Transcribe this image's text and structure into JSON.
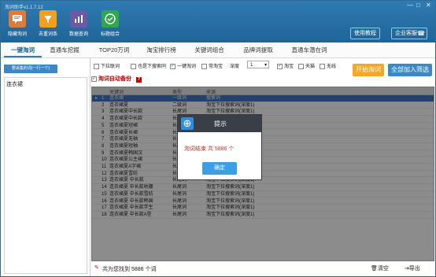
{
  "window": {
    "title": "淘词助手v1.1.7.12",
    "controls": [
      "—",
      "□",
      "✕"
    ]
  },
  "toolbar": [
    {
      "label": "隐藏淘词",
      "color": "#e07a3a",
      "icon": "chat-icon"
    },
    {
      "label": "去重词条",
      "color": "#f0a020",
      "icon": "filter-icon"
    },
    {
      "label": "数据查询",
      "color": "#6a5aa8",
      "icon": "chart-icon"
    },
    {
      "label": "标题组合",
      "color": "#2ea84a",
      "icon": "check-icon"
    }
  ],
  "header_buttons": {
    "tutorial": "使用教程",
    "service": "企业客服"
  },
  "tabs": [
    "一键淘词",
    "直通车挖掘",
    "TOP20万词",
    "淘宝排行榜",
    "关键词组合",
    "品牌词提取",
    "直通车潜在词"
  ],
  "left": {
    "button": "要采集的词(一行一个)",
    "item": "连衣裙"
  },
  "options": [
    {
      "label": "下拉联词",
      "checked": false
    },
    {
      "label": "也是下搜索同",
      "checked": false
    },
    {
      "label": "一键淘词",
      "checked": true
    },
    {
      "label": "常淘宝",
      "checked": false
    },
    {
      "label": "深度",
      "checked": false
    }
  ],
  "depth": "1",
  "platforms": [
    {
      "label": "淘宝",
      "checked": true
    },
    {
      "label": "天猫",
      "checked": false
    },
    {
      "label": "无线",
      "checked": false
    }
  ],
  "start_button": "开始淘词",
  "add_button": "全部加入筛选",
  "auto_backup": "淘词自动备份",
  "help": "?",
  "table": {
    "headers": [
      "关键词",
      "类型",
      "来源"
    ],
    "rows": [
      [
        "1",
        "连衣裙",
        "一级词",
        "搜索词"
      ],
      [
        "2",
        "连衣裙夏",
        "二级词",
        "淘宝下拉搜索词(深度1)"
      ],
      [
        "3",
        "连衣裙夏中长款",
        "长尾词",
        "淘宝下拉搜索词(深度1)"
      ],
      [
        "4",
        "连衣裙夏中长款",
        "长尾词",
        "淘宝下拉搜索词(深度1)"
      ],
      [
        "5",
        "连衣裙夏短裙",
        "长尾词",
        "淘宝下拉搜索词(深度1)"
      ],
      [
        "6",
        "连衣裙夏长裙",
        "长尾词",
        "淘宝下拉搜索词(深度1)"
      ],
      [
        "7",
        "连衣裙夏无袖",
        "长尾词",
        "淘宝下拉搜索词(深度1)"
      ],
      [
        "8",
        "连衣裙夏短袖",
        "长尾词",
        "淘宝下拉搜索词(深度1)"
      ],
      [
        "9",
        "连衣裙夏韩国汉",
        "长尾词",
        "淘宝下拉搜索词(深度1)"
      ],
      [
        "10",
        "连衣裙夏公主裙",
        "长尾词",
        "淘宝下拉搜索词(深度1)"
      ],
      [
        "11",
        "连衣裙夏A字裙",
        "长尾词",
        "淘宝下拉搜索词(深度1)"
      ],
      [
        "12",
        "连衣裙夏雪纺",
        "长尾词",
        "淘宝下拉搜索词(深度1)"
      ],
      [
        "13",
        "连衣裙夏 中长款",
        "长尾词",
        "淘宝下拉搜索词(深度1)"
      ],
      [
        "14",
        "连衣裙夏 中长款收腰",
        "长尾词",
        "淘宝下拉搜索词(深度1)"
      ],
      [
        "15",
        "连衣裙夏 中长款雪纺",
        "长尾词",
        "淘宝下拉搜索词(深度1)"
      ],
      [
        "16",
        "连衣裙夏 中长款韩国",
        "长尾词",
        "淘宝下拉搜索词(深度1)"
      ],
      [
        "17",
        "连衣裙夏 中长款学生",
        "长尾词",
        "淘宝下拉搜索词(深度1)"
      ],
      [
        "18",
        "连衣裙夏 中长款A型",
        "长尾词",
        "淘宝下拉搜索词(深度1)"
      ]
    ]
  },
  "footer": {
    "summary": "共为您找到 5886 个词",
    "clear": "清空",
    "export": "导出"
  },
  "dialog": {
    "title": "提示",
    "message": "淘词结束 共 5886 个",
    "ok": "确定"
  }
}
